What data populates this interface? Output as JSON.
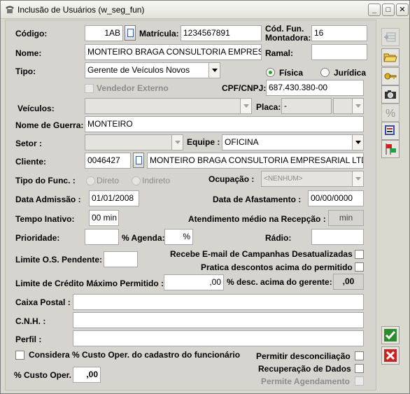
{
  "window": {
    "title": "Inclusão de Usuários (w_seg_fun)",
    "minimize": "_",
    "maximize": "□",
    "close": "✕"
  },
  "form": {
    "codigo": {
      "label": "Código:",
      "value": "1AB"
    },
    "matricula": {
      "label": "Matrícula:",
      "value": "1234567891"
    },
    "cod_fun_montadora": {
      "label": "Cód. Fun. Montadora:",
      "value": "16"
    },
    "nome": {
      "label": "Nome:",
      "value": "MONTEIRO BRAGA CONSULTORIA EMPRESARIAL LTD"
    },
    "ramal": {
      "label": "Ramal:",
      "value": ""
    },
    "tipo": {
      "label": "Tipo:",
      "value": "Gerente de Veículos Novos"
    },
    "fisica": {
      "label": "Física",
      "checked": true
    },
    "juridica": {
      "label": "Jurídica",
      "checked": false
    },
    "vendedor_externo": {
      "label": "Vendedor Externo",
      "checked": false
    },
    "cpf_cnpj": {
      "label": "CPF/CNPJ:",
      "value": "687.430.380-00"
    },
    "veiculos": {
      "label": "Veículos:",
      "value": ""
    },
    "placa": {
      "label": "Placa:",
      "value": "-"
    },
    "nome_guerra": {
      "label": "Nome de Guerra:",
      "value": "MONTEIRO"
    },
    "setor": {
      "label": "Setor :",
      "value": ""
    },
    "equipe": {
      "label": "Equipe :",
      "value": "OFICINA"
    },
    "cliente": {
      "label": "Cliente:",
      "code": "0046427",
      "name": "MONTEIRO BRAGA CONSULTORIA EMPRESARIAL LTD"
    },
    "tipo_func": {
      "label": "Tipo do Func. :",
      "direto": "Direto",
      "indireto": "Indireto"
    },
    "ocupacao": {
      "label": "Ocupação :",
      "value": "<NENHUM>"
    },
    "data_admissao": {
      "label": "Data Admissão :",
      "value": "01/01/2008"
    },
    "data_afastamento": {
      "label": "Data de Afastamento :",
      "value": "00/00/0000"
    },
    "tempo_inativo": {
      "label": "Tempo Inativo:",
      "value": "00 min"
    },
    "atendimento_medio": {
      "label": "Atendimento médio na Recepção :",
      "value": "min"
    },
    "prioridade": {
      "label": "Prioridade:",
      "value": ""
    },
    "pct_agenda": {
      "label": "% Agenda:",
      "value": "%"
    },
    "radio_field": {
      "label": "Rádio:",
      "value": ""
    },
    "limite_os": {
      "label": "Limite O.S. Pendente:",
      "value": ""
    },
    "recebe_email": {
      "label": "Recebe E-mail de Campanhas Desatualizadas",
      "checked": false
    },
    "pratica_descontos": {
      "label": "Pratica descontos acima do permitido",
      "checked": false
    },
    "limite_credito": {
      "label": "Limite de Crédito Máximo Permitido :",
      "value": ",00"
    },
    "desc_gerente": {
      "label": "% desc. acima do gerente:",
      "value": ",00"
    },
    "caixa_postal": {
      "label": "Caixa Postal :",
      "value": ""
    },
    "cnh": {
      "label": "C.N.H. :",
      "value": ""
    },
    "perfil": {
      "label": "Perfil :",
      "value": ""
    },
    "considera_custo": {
      "label": "Considera % Custo Oper. do cadastro do funcionário",
      "checked": false
    },
    "permitir_desconciliacao": {
      "label": "Permitir desconciliação",
      "checked": false
    },
    "recuperacao_dados": {
      "label": "Recuperação de Dados",
      "checked": false
    },
    "permite_agendamento": {
      "label": "Permite Agendamento",
      "checked": false
    },
    "custo_oper": {
      "label": "% Custo Oper.",
      "value": ",00"
    }
  },
  "toolbar_icons": [
    "add-row-icon",
    "open-folder-icon",
    "keys-icon",
    "camera-icon",
    "percent-icon",
    "report-icon",
    "flags-icon",
    "confirm-icon",
    "cancel-icon"
  ],
  "colors": {
    "confirm": "#2e8b2e",
    "cancel": "#cc2222",
    "radio_selected": "#2aa22a"
  }
}
